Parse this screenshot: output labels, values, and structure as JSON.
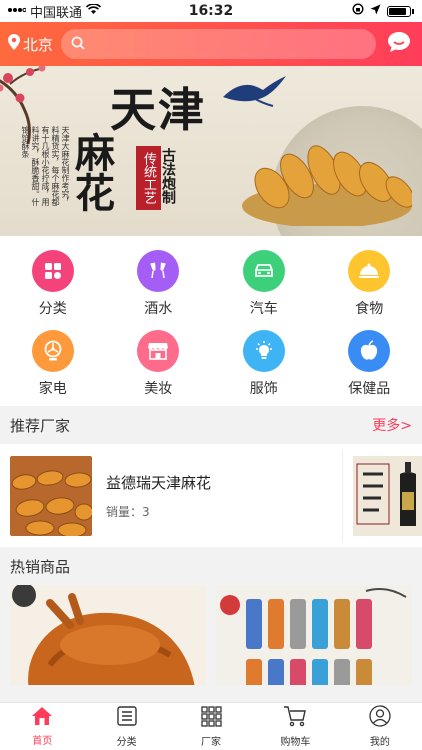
{
  "status": {
    "carrier": "中国联通",
    "time": "16:32"
  },
  "header": {
    "city": "北京"
  },
  "banner": {
    "title": "天津",
    "vertical_title": "麻花",
    "tag_red": "传统工艺",
    "tag_black": "古法炮制",
    "description": "天津大麻花制作考究，料精货实，每个麻花都有十几根小花拧成，用料讲究，酥脆香甜。什锦馅酥条"
  },
  "categories": [
    {
      "label": "分类",
      "icon": "grid-icon",
      "color": "#f4437a"
    },
    {
      "label": "酒水",
      "icon": "wine-glasses-icon",
      "color": "#a45ef5"
    },
    {
      "label": "汽车",
      "icon": "car-icon",
      "color": "#3cd07a"
    },
    {
      "label": "食物",
      "icon": "food-cloche-icon",
      "color": "#ffc52e"
    },
    {
      "label": "家电",
      "icon": "fan-icon",
      "color": "#ff9a3c"
    },
    {
      "label": "美妆",
      "icon": "store-icon",
      "color": "#ff6b8a"
    },
    {
      "label": "服饰",
      "icon": "lightbulb-icon",
      "color": "#3fb4f5"
    },
    {
      "label": "保健品",
      "icon": "apple-icon",
      "color": "#3a8cf5"
    }
  ],
  "recommended": {
    "heading": "推荐厂家",
    "more": "更多>",
    "vendors": [
      {
        "name": "益德瑞天津麻花",
        "sales_label": "销量：",
        "sales": "3"
      }
    ],
    "second_vendor_image": "liquor-bottle"
  },
  "hot": {
    "heading": "热销商品"
  },
  "tabbar": [
    {
      "label": "首页",
      "icon": "home-icon",
      "active": true
    },
    {
      "label": "分类",
      "icon": "list-icon",
      "active": false
    },
    {
      "label": "厂家",
      "icon": "grid-dots-icon",
      "active": false
    },
    {
      "label": "购物车",
      "icon": "cart-icon",
      "active": false
    },
    {
      "label": "我的",
      "icon": "user-icon",
      "active": false
    }
  ],
  "colors": {
    "accent": "#ff3d5a",
    "header_start": "#ff6a3d"
  }
}
